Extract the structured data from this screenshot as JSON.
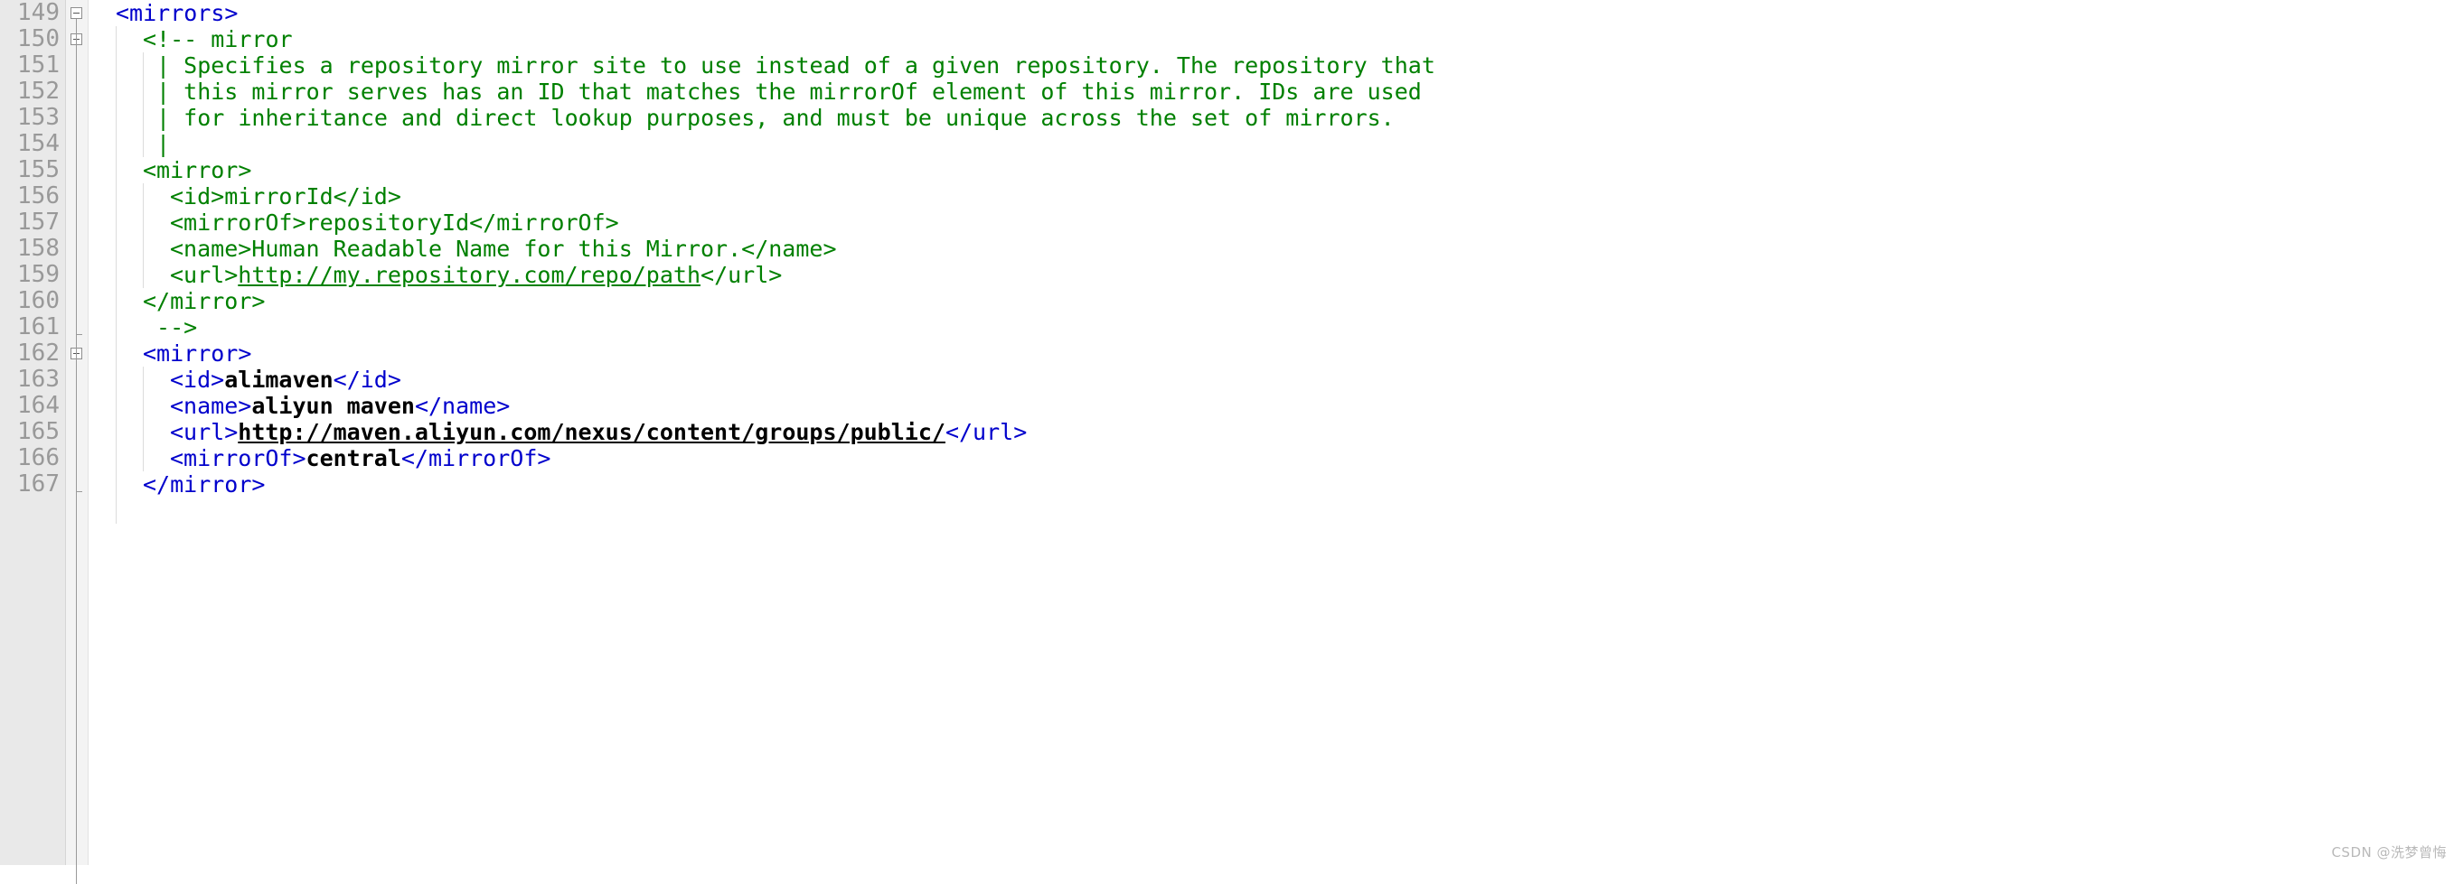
{
  "editor": {
    "kind": "xml-code-editor",
    "file_kind": "maven-settings-xml",
    "colors": {
      "gutter_bg": "#e9e9e9",
      "fold_bg": "#f3f3f3",
      "line_number": "#999999",
      "tag": "#0000cc",
      "comment": "#008000",
      "value": "#000000",
      "background": "#ffffff",
      "indent_guide": "#dcdcdc"
    },
    "first_line": 149,
    "last_line": 167,
    "line_height_px": 29
  },
  "gutter": {
    "line_numbers": [
      "149",
      "150",
      "151",
      "152",
      "153",
      "154",
      "155",
      "156",
      "157",
      "158",
      "159",
      "160",
      "161",
      "162",
      "163",
      "164",
      "165",
      "166",
      "167"
    ],
    "fold_markers": [
      {
        "line": "149",
        "type": "collapse-box"
      },
      {
        "line": "150",
        "type": "collapse-box"
      },
      {
        "line": "162",
        "type": "collapse-box"
      }
    ]
  },
  "lines": [
    {
      "number": "149",
      "indent": 0,
      "segments": [
        {
          "text": "<mirrors>",
          "style": "tag"
        }
      ]
    },
    {
      "number": "150",
      "indent": 1,
      "segments": [
        {
          "text": "<!-- mirror",
          "style": "comment"
        }
      ]
    },
    {
      "number": "151",
      "indent": 1,
      "segments": [
        {
          "text": " | Specifies a repository mirror site to use instead of a given repository. The repository that",
          "style": "comment"
        }
      ]
    },
    {
      "number": "152",
      "indent": 1,
      "segments": [
        {
          "text": " | this mirror serves has an ID that matches the mirrorOf element of this mirror. IDs are used",
          "style": "comment"
        }
      ]
    },
    {
      "number": "153",
      "indent": 1,
      "segments": [
        {
          "text": " | for inheritance and direct lookup purposes, and must be unique across the set of mirrors.",
          "style": "comment"
        }
      ]
    },
    {
      "number": "154",
      "indent": 1,
      "segments": [
        {
          "text": " |",
          "style": "comment"
        }
      ]
    },
    {
      "number": "155",
      "indent": 1,
      "segments": [
        {
          "text": "<mirror>",
          "style": "comment"
        }
      ]
    },
    {
      "number": "156",
      "indent": 2,
      "segments": [
        {
          "text": "<id>mirrorId</id>",
          "style": "comment"
        }
      ]
    },
    {
      "number": "157",
      "indent": 2,
      "segments": [
        {
          "text": "<mirrorOf>repositoryId</mirrorOf>",
          "style": "comment"
        }
      ]
    },
    {
      "number": "158",
      "indent": 2,
      "segments": [
        {
          "text": "<name>Human Readable Name for this Mirror.</name>",
          "style": "comment"
        }
      ]
    },
    {
      "number": "159",
      "indent": 2,
      "segments": [
        {
          "text": "<url>",
          "style": "comment"
        },
        {
          "text": "http://my.repository.com/repo/path",
          "style": "comment-link"
        },
        {
          "text": "</url>",
          "style": "comment"
        }
      ]
    },
    {
      "number": "160",
      "indent": 1,
      "segments": [
        {
          "text": "</mirror>",
          "style": "comment"
        }
      ]
    },
    {
      "number": "161",
      "indent": 1,
      "segments": [
        {
          "text": " -->",
          "style": "comment"
        }
      ]
    },
    {
      "number": "162",
      "indent": 1,
      "segments": [
        {
          "text": "<mirror>",
          "style": "tag"
        }
      ]
    },
    {
      "number": "163",
      "indent": 2,
      "segments": [
        {
          "text": "<id>",
          "style": "tag"
        },
        {
          "text": "alimaven",
          "style": "value"
        },
        {
          "text": "</id>",
          "style": "tag"
        }
      ]
    },
    {
      "number": "164",
      "indent": 2,
      "segments": [
        {
          "text": "<name>",
          "style": "tag"
        },
        {
          "text": "aliyun maven",
          "style": "value"
        },
        {
          "text": "</name>",
          "style": "tag"
        }
      ]
    },
    {
      "number": "165",
      "indent": 2,
      "segments": [
        {
          "text": "<url>",
          "style": "tag"
        },
        {
          "text": "http://maven.aliyun.com/nexus/content/groups/public/",
          "style": "value-link"
        },
        {
          "text": "</url>",
          "style": "tag"
        }
      ]
    },
    {
      "number": "166",
      "indent": 2,
      "segments": [
        {
          "text": "<mirrorOf>",
          "style": "tag"
        },
        {
          "text": "central",
          "style": "value"
        },
        {
          "text": "</mirrorOf>",
          "style": "tag"
        }
      ]
    },
    {
      "number": "167",
      "indent": 1,
      "segments": [
        {
          "text": "</mirror>",
          "style": "tag"
        }
      ]
    }
  ],
  "watermark": {
    "text": "CSDN @洗梦曾悔"
  }
}
